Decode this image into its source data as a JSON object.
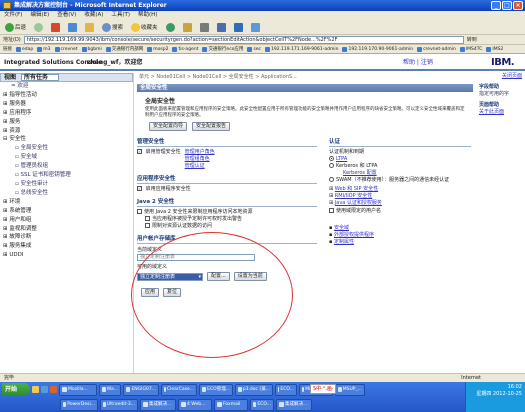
{
  "window": {
    "title": "集成解决方案控制台 - Microsoft Internet Explorer",
    "menu": [
      "文件(F)",
      "编辑(E)",
      "查看(V)",
      "收藏(A)",
      "工具(T)",
      "帮助(H)"
    ],
    "toolbar": {
      "back_label": "后退",
      "search_label": "搜索",
      "favorites_label": "收藏夹"
    },
    "address_label": "地址(D)",
    "address_value": "https://192.119.169.99:9043/ibm/console/secure/securityrgen.do?action=sectionEditAction&objectCellT%2FNode...%2F%2F",
    "go_label": "转到",
    "links_label": "链接",
    "links": [
      "edap",
      "m3",
      "crevnet",
      "bgbmi",
      "交通银行内部网",
      "mosp2",
      "tis-agent",
      "交通银行eco应用",
      "sec",
      "192.119.171.169-9061-admin",
      "192.119.170.90-9061-admin",
      "crevnet-admin",
      "IMS4TC",
      "IMS2"
    ],
    "status_left": "完毕",
    "status_right": "Internet"
  },
  "console": {
    "name": "Integrated Solutions Console",
    "welcome": "zhang_wf，欢迎您",
    "help_links": "帮助 | 注销",
    "brand": "IBM."
  },
  "sidebar": {
    "view_label": "视图",
    "view_value": "所有任务",
    "items": [
      {
        "label": "= 欢迎",
        "type": "sub0"
      },
      {
        "label": "⊞ 指导性活动",
        "type": "grp"
      },
      {
        "label": "⊞ 服务器",
        "type": "grp"
      },
      {
        "label": "⊞ 应用程序",
        "type": "grp"
      },
      {
        "label": "⊞ 服务",
        "type": "grp"
      },
      {
        "label": "⊞ 资源",
        "type": "grp"
      },
      {
        "label": "⊟ 安全性",
        "type": "grp"
      },
      {
        "label": "▫ 全局安全性",
        "type": "sub"
      },
      {
        "label": "▫ 安全域",
        "type": "sub"
      },
      {
        "label": "▫ 管理员权组",
        "type": "sub"
      },
      {
        "label": "▫ SSL 证书和密钥管理",
        "type": "sub"
      },
      {
        "label": "▫ 安全性审计",
        "type": "sub"
      },
      {
        "label": "▫ 总线安全性",
        "type": "sub"
      },
      {
        "label": "⊞ 环境",
        "type": "grp"
      },
      {
        "label": "⊞ 系统管理",
        "type": "grp"
      },
      {
        "label": "⊞ 用户和组",
        "type": "grp"
      },
      {
        "label": "⊞ 监视和调整",
        "type": "grp"
      },
      {
        "label": "⊞ 故障诊断",
        "type": "grp"
      },
      {
        "label": "⊞ 服务集成",
        "type": "grp"
      },
      {
        "label": "⊞ UDDI",
        "type": "grp"
      }
    ]
  },
  "rightcol": {
    "close_link": "关闭页面",
    "box1_title": "字段帮助",
    "box1_text": "指定可用的字",
    "box2_title": "页面帮助",
    "box2_link": "关于此页面"
  },
  "main": {
    "breadcrumb": "单元 > Node01Cell > Node01Cell > 全局安全性 > ApplicationS...",
    "panel_title": "全局安全性",
    "section_title": "全局安全性",
    "description": "使用此面板来配置管理和应用程序的安全策略。此安全性配置应用于所有管理功能的安全策略并用作用户应用程序的缺省安全策略。可以定义安全性域来覆盖和定制用户应用程序的安全策略。",
    "wizard_button": "安全配置向导",
    "report_button": "安全配置报告",
    "admin_security": {
      "title": "管理安全性",
      "enable_label": "启用管理安全性",
      "links": [
        "管理用户角色",
        "管理组角色",
        "管理认证"
      ]
    },
    "app_security": {
      "title": "应用程序安全性",
      "enable_label": "启用应用程序安全性"
    },
    "java2_security": {
      "title": "Java 2 安全性",
      "use_label": "使用 Java 2 安全性来限制应用程序访问本地资源",
      "warn_label": "当应用程序被授予定制许可权时发出警告",
      "restrict_label": "限制对资源认证数据的访问"
    },
    "user_registry": {
      "title": "用户帐户存储库",
      "realm_label": "当前域定义",
      "realm_value": "独立定制注册表",
      "available_label": "可用的域定义",
      "available_value": "独立定制注册表",
      "configure_button": "配置...",
      "set_current_button": "设置为当前"
    },
    "auth": {
      "title": "认证",
      "mechanism_label": "认证机制和到期",
      "ltpa_label": "LTPA",
      "kerberos_label": "Kerberos 和 LTPA",
      "kerberos_config": "Kerberos 配置",
      "swam_label": "SWAM（不推荐使用）：服务器之间的通信未经认证",
      "links": [
        "Web 和 SIP 安全性",
        "RMI/IIOP 安全性",
        "Java 认证和授权服务"
      ],
      "fedid_label": "使用域限定的用户名"
    },
    "extra_links": [
      "安全域",
      "外部授权提供程序",
      "定制属性"
    ],
    "apply_button": "应用",
    "reset_button": "复位"
  },
  "taskbar": {
    "start_label": "开始",
    "row1": [
      "Mozilla...",
      "Wa...",
      "ENGIG07...",
      "ClearCase...",
      "ECO管理...",
      "p3.doc [兼...",
      "ECO...",
      "Microsoft...",
      "MSUP_..."
    ],
    "row2": [
      "PowerDesi...",
      "Ultraedit-3...",
      "集成解决...",
      "4 Web...",
      "Foxmail",
      "ECO...",
      "集成解决..."
    ],
    "ime_label": "S中·°,画·",
    "clock": "16:02",
    "date_label": "星期四 2012-10-25"
  }
}
